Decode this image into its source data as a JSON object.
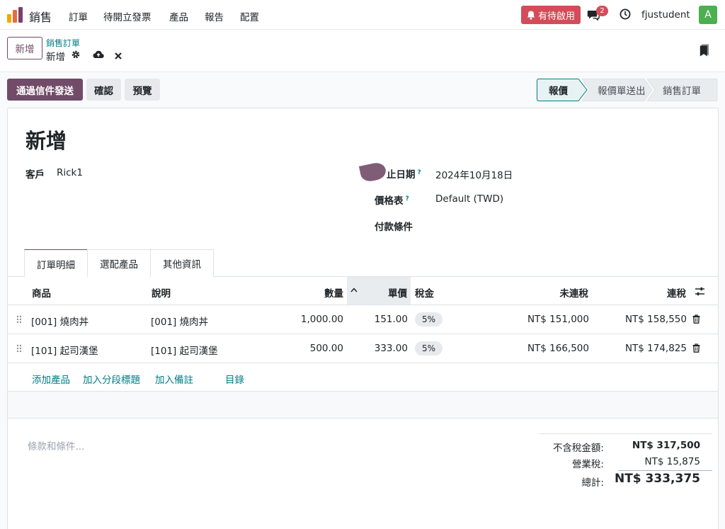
{
  "navbar": {
    "app_name": "銷售",
    "menu": [
      "訂單",
      "待開立發票",
      "產品",
      "報告",
      "配置"
    ],
    "activity_label": "有待啟用",
    "chat_count": "2",
    "user_name": "fjustudent",
    "avatar_letter": "A"
  },
  "control_panel": {
    "new_label": "新增",
    "breadcrumb_parent": "銷售訂單",
    "breadcrumb_current": "新增"
  },
  "actions": {
    "send_email": "通過信件發送",
    "confirm": "確認",
    "preview": "預覽"
  },
  "status_stages": [
    {
      "label": "報價",
      "active": true
    },
    {
      "label": "報價單送出",
      "active": false
    },
    {
      "label": "銷售訂單",
      "active": false
    }
  ],
  "form": {
    "title": "新增",
    "customer_label": "客戶",
    "customer_value": "Rick1",
    "expiry_label": "止日期",
    "expiry_value": "2024年10月18日",
    "pricelist_label": "價格表",
    "pricelist_value": "Default (TWD)",
    "payment_terms_label": "付款條件",
    "help_mark": "?"
  },
  "tabs": [
    "訂單明細",
    "選配產品",
    "其他資訊"
  ],
  "table": {
    "headers": {
      "product": "商品",
      "description": "說明",
      "quantity": "數量",
      "unit_price": "單價",
      "taxes": "稅金",
      "subtotal": "未連稅",
      "total": "連稅"
    },
    "rows": [
      {
        "product": "[001] 燒肉丼",
        "description": "[001] 燒肉丼",
        "quantity": "1,000.00",
        "unit_price": "151.00",
        "tax": "5%",
        "subtotal": "NT$ 151,000",
        "total": "NT$ 158,550"
      },
      {
        "product": "[101] 起司漢堡",
        "description": "[101] 起司漢堡",
        "quantity": "500.00",
        "unit_price": "333.00",
        "tax": "5%",
        "subtotal": "NT$ 166,500",
        "total": "NT$ 174,825"
      }
    ],
    "add_links": [
      "添加產品",
      "加入分段標題",
      "加入備註",
      "目錄"
    ]
  },
  "terms_placeholder": "條款和條件...",
  "totals": {
    "untaxed_label": "不含稅金額:",
    "untaxed_value": "NT$ 317,500",
    "tax_label": "營業稅:",
    "tax_value": "NT$ 15,875",
    "total_label": "總計:",
    "total_value": "NT$ 333,375"
  },
  "colors": {
    "brand": "#714b67",
    "link": "#017e84",
    "danger": "#d44c59"
  }
}
